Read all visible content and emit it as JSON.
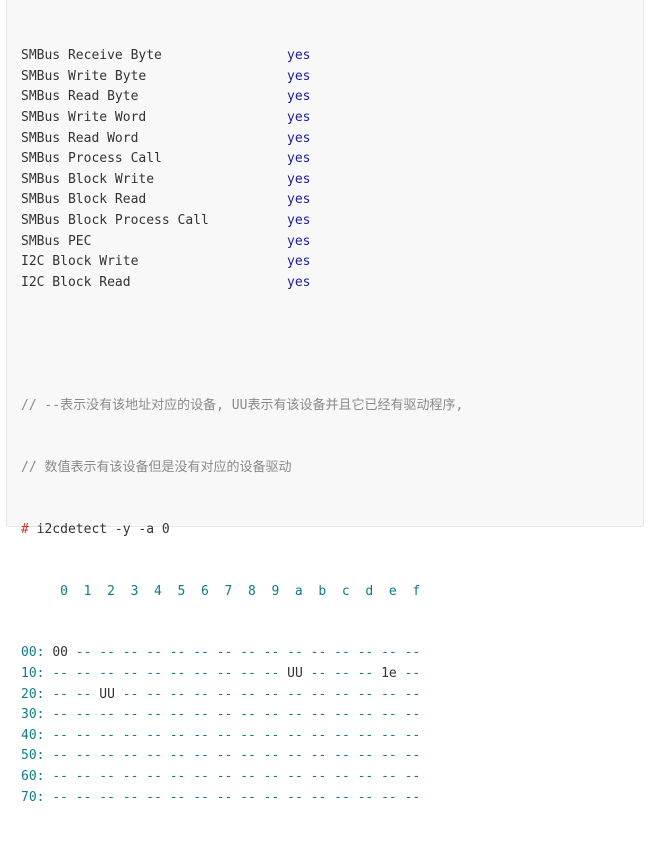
{
  "functionalities": [
    {
      "name": "SMBus Receive Byte",
      "value": "yes"
    },
    {
      "name": "SMBus Write Byte",
      "value": "yes"
    },
    {
      "name": "SMBus Read Byte",
      "value": "yes"
    },
    {
      "name": "SMBus Write Word",
      "value": "yes"
    },
    {
      "name": "SMBus Read Word",
      "value": "yes"
    },
    {
      "name": "SMBus Process Call",
      "value": "yes"
    },
    {
      "name": "SMBus Block Write",
      "value": "yes"
    },
    {
      "name": "SMBus Block Read",
      "value": "yes"
    },
    {
      "name": "SMBus Block Process Call",
      "value": "yes"
    },
    {
      "name": "SMBus PEC",
      "value": "yes"
    },
    {
      "name": "I2C Block Write",
      "value": "yes"
    },
    {
      "name": "I2C Block Read",
      "value": "yes"
    }
  ],
  "comments": [
    "// --表示没有该地址对应的设备, UU表示有该设备并且它已经有驱动程序,",
    "// 数值表示有该设备但是没有对应的设备驱动"
  ],
  "command": {
    "prompt": "#",
    "text": "i2cdetect -y -a 0"
  },
  "hex_header": "     0  1  2  3  4  5  6  7  8  9  a  b  c  d  e  f",
  "rows": [
    {
      "label": "00:",
      "cells": [
        "00",
        "--",
        "--",
        "--",
        "--",
        "--",
        "--",
        "--",
        "--",
        "--",
        "--",
        "--",
        "--",
        "--",
        "--",
        "--"
      ]
    },
    {
      "label": "10:",
      "cells": [
        "--",
        "--",
        "--",
        "--",
        "--",
        "--",
        "--",
        "--",
        "--",
        "--",
        "UU",
        "--",
        "--",
        "--",
        "1e",
        "--"
      ]
    },
    {
      "label": "20:",
      "cells": [
        "--",
        "--",
        "UU",
        "--",
        "--",
        "--",
        "--",
        "--",
        "--",
        "--",
        "--",
        "--",
        "--",
        "--",
        "--",
        "--"
      ]
    },
    {
      "label": "30:",
      "cells": [
        "--",
        "--",
        "--",
        "--",
        "--",
        "--",
        "--",
        "--",
        "--",
        "--",
        "--",
        "--",
        "--",
        "--",
        "--",
        "--"
      ]
    },
    {
      "label": "40:",
      "cells": [
        "--",
        "--",
        "--",
        "--",
        "--",
        "--",
        "--",
        "--",
        "--",
        "--",
        "--",
        "--",
        "--",
        "--",
        "--",
        "--"
      ]
    },
    {
      "label": "50:",
      "cells": [
        "--",
        "--",
        "--",
        "--",
        "--",
        "--",
        "--",
        "--",
        "--",
        "--",
        "--",
        "--",
        "--",
        "--",
        "--",
        "--"
      ]
    },
    {
      "label": "60:",
      "cells": [
        "--",
        "--",
        "--",
        "--",
        "--",
        "--",
        "--",
        "--",
        "--",
        "--",
        "--",
        "--",
        "--",
        "--",
        "--",
        "--"
      ]
    },
    {
      "label": "70:",
      "cells": [
        "--",
        "--",
        "--",
        "--",
        "--",
        "--",
        "--",
        "--",
        "--",
        "--",
        "--",
        "--",
        "--",
        "--",
        "--",
        "--"
      ]
    }
  ]
}
